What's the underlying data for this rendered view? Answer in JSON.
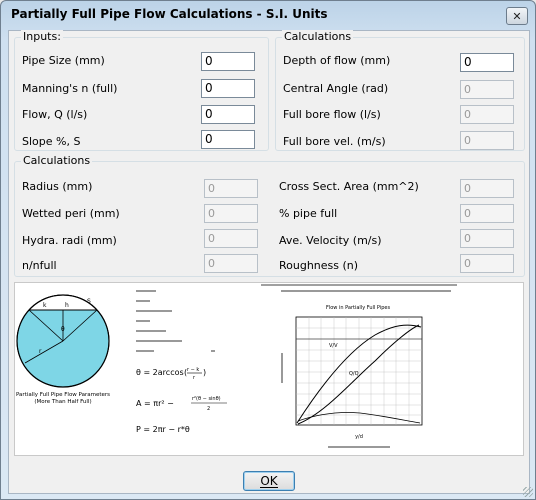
{
  "window": {
    "title": "Partially Full Pipe Flow Calculations - S.I. Units",
    "close_glyph": "✕"
  },
  "inputs": {
    "legend": "Inputs:",
    "fields": [
      {
        "label": "Pipe Size (mm)",
        "value": "0",
        "enabled": true
      },
      {
        "label": "Manning's n (full)",
        "value": "0",
        "enabled": true
      },
      {
        "label": "Flow, Q (l/s)",
        "value": "0",
        "enabled": false
      },
      {
        "label": "Slope %, S",
        "value": "0",
        "enabled": true
      }
    ]
  },
  "calculations_top": {
    "legend": "Calculations",
    "fields": [
      {
        "label": "Depth of flow (mm)",
        "value": "0",
        "enabled": true
      },
      {
        "label": "Central Angle (rad)",
        "value": "0",
        "enabled": false
      },
      {
        "label": "Full bore flow (l/s)",
        "value": "0",
        "enabled": false
      },
      {
        "label": "Full bore vel. (m/s)",
        "value": "0",
        "enabled": false
      }
    ]
  },
  "calculations_bottom": {
    "legend": "Calculations",
    "left": [
      {
        "label": "Radius (mm)",
        "value": "0"
      },
      {
        "label": "Wetted peri (mm)",
        "value": "0"
      },
      {
        "label": "Hydra. radi (mm)",
        "value": "0"
      },
      {
        "label": "n/nfull",
        "value": "0"
      }
    ],
    "right": [
      {
        "label": "Cross Sect. Area (mm^2)",
        "value": "0"
      },
      {
        "label": "% pipe full",
        "value": "0"
      },
      {
        "label": "Ave. Velocity (m/s)",
        "value": "0"
      },
      {
        "label": "Roughness (n)",
        "value": "0"
      }
    ]
  },
  "figure": {
    "pipe_caption_1": "Partially Full Pipe Flow Parameters",
    "pipe_caption_2": "(More Than Half Full)",
    "pipe_colors": {
      "water": "#7ed6e6",
      "outline": "#000000"
    },
    "eq1": "θ = 2arccos",
    "eq2": "A = πr² −",
    "eq3": "P = 2πr − r*θ",
    "graph_title": "Flow in Partially Full Pipes",
    "curve_label_1": "V/V",
    "curve_label_2": "Q/Q",
    "x_label": "y/d"
  },
  "ok_button": {
    "label": "OK"
  }
}
